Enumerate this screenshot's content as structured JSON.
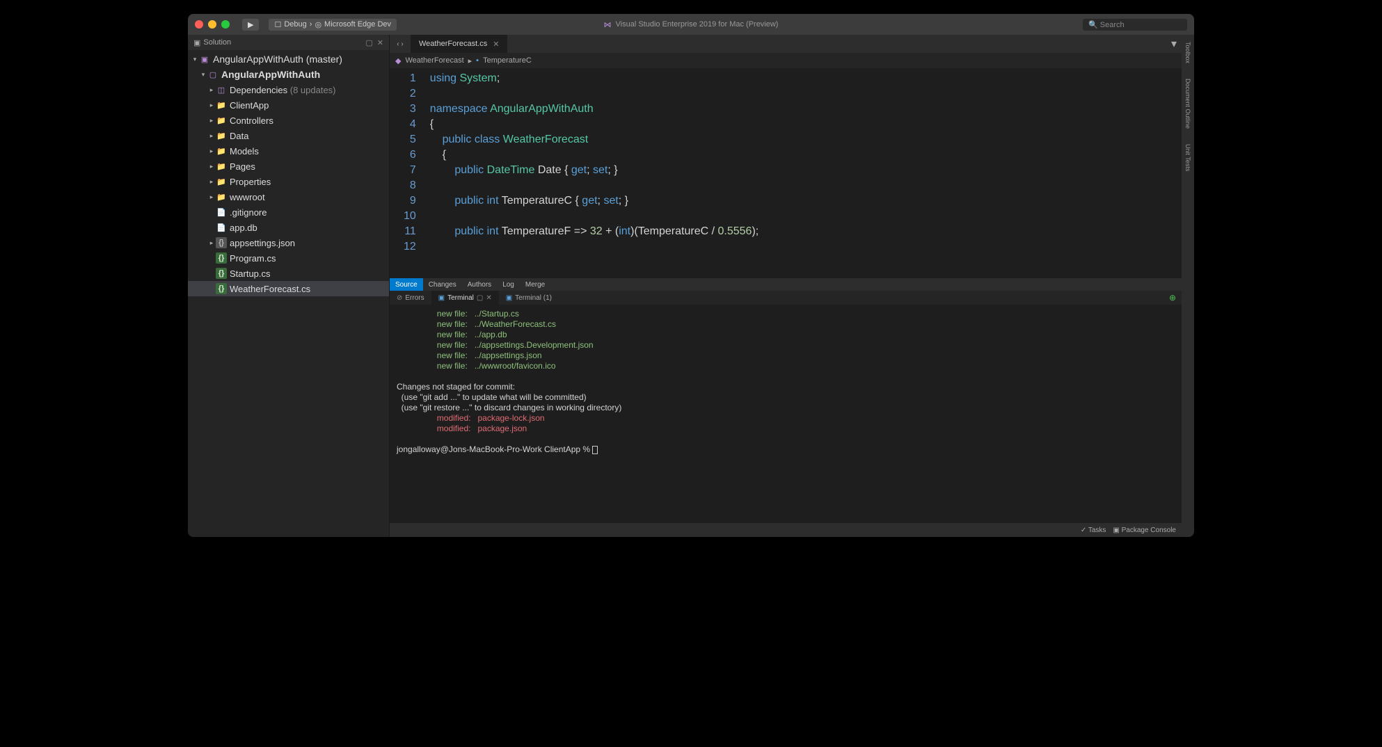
{
  "titlebar": {
    "config": "Debug",
    "target": "Microsoft Edge Dev",
    "app_title": "Visual Studio Enterprise 2019 for Mac (Preview)",
    "search_placeholder": "Search"
  },
  "solution_panel": {
    "title": "Solution",
    "root": "AngularAppWithAuth (master)",
    "project": "AngularAppWithAuth",
    "deps_label": "Dependencies",
    "deps_badge": "(8 updates)",
    "folders": [
      "ClientApp",
      "Controllers",
      "Data",
      "Models",
      "Pages",
      "Properties",
      "wwwroot"
    ],
    "files": [
      {
        "name": ".gitignore",
        "icon": "file"
      },
      {
        "name": "app.db",
        "icon": "file"
      },
      {
        "name": "appsettings.json",
        "icon": "json",
        "expand": true
      },
      {
        "name": "Program.cs",
        "icon": "cs"
      },
      {
        "name": "Startup.cs",
        "icon": "cs"
      },
      {
        "name": "WeatherForecast.cs",
        "icon": "cs",
        "selected": true
      }
    ]
  },
  "tab": {
    "name": "WeatherForecast.cs"
  },
  "breadcrumb": {
    "a": "WeatherForecast",
    "b": "TemperatureC"
  },
  "code_lines": [
    "1",
    "2",
    "3",
    "4",
    "5",
    "6",
    "7",
    "8",
    "9",
    "10",
    "11",
    "12"
  ],
  "code": {
    "l1a": "using",
    "l1b": "System",
    "l3a": "namespace",
    "l3b": "AngularAppWithAuth",
    "l5a": "public",
    "l5b": "class",
    "l5c": "WeatherForecast",
    "l7a": "public",
    "l7b": "DateTime",
    "l7c": "Date",
    "l7d": "get",
    "l7e": "set",
    "l9a": "public",
    "l9b": "int",
    "l9c": "TemperatureC",
    "l9d": "get",
    "l9e": "set",
    "l11a": "public",
    "l11b": "int",
    "l11c": "TemperatureF",
    "l11d": "32",
    "l11e": "int",
    "l11f": "TemperatureC",
    "l11g": "0.5556"
  },
  "mid_tabs": [
    "Source",
    "Changes",
    "Authors",
    "Log",
    "Merge"
  ],
  "lower_tabs": {
    "errors": "Errors",
    "terminal": "Terminal",
    "terminal1": "Terminal (1)"
  },
  "terminal": {
    "nf": "new file:",
    "files": [
      "../Startup.cs",
      "../WeatherForecast.cs",
      "../app.db",
      "../appsettings.Development.json",
      "../appsettings.json",
      "../wwwroot/favicon.ico"
    ],
    "head": "Changes not staged for commit:",
    "hint1": "  (use \"git add <file>...\" to update what will be committed)",
    "hint2": "  (use \"git restore <file>...\" to discard changes in working directory)",
    "mod": "modified:",
    "mods": [
      "package-lock.json",
      "package.json"
    ],
    "prompt": "jongalloway@Jons-MacBook-Pro-Work ClientApp % "
  },
  "status": {
    "tasks": "Tasks",
    "pkg": "Package Console"
  },
  "right_rail": [
    "Toolbox",
    "Document Outline",
    "Unit Tests"
  ]
}
